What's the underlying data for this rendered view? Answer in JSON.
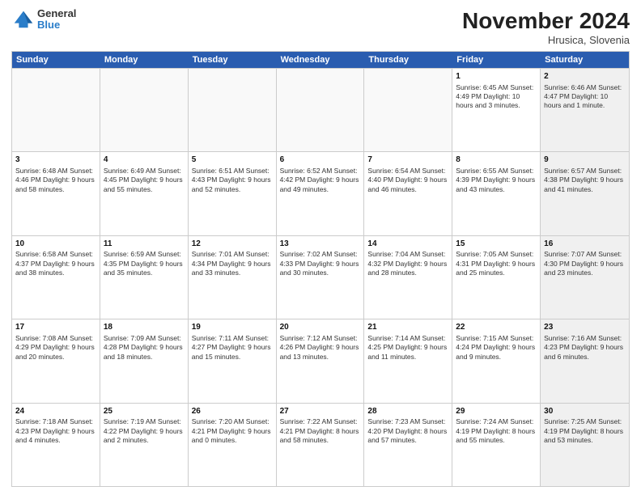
{
  "header": {
    "logo_line1": "General",
    "logo_line2": "Blue",
    "month": "November 2024",
    "location": "Hrusica, Slovenia"
  },
  "days": [
    "Sunday",
    "Monday",
    "Tuesday",
    "Wednesday",
    "Thursday",
    "Friday",
    "Saturday"
  ],
  "weeks": [
    [
      {
        "date": "",
        "info": "",
        "empty": true
      },
      {
        "date": "",
        "info": "",
        "empty": true
      },
      {
        "date": "",
        "info": "",
        "empty": true
      },
      {
        "date": "",
        "info": "",
        "empty": true
      },
      {
        "date": "",
        "info": "",
        "empty": true
      },
      {
        "date": "1",
        "info": "Sunrise: 6:45 AM\nSunset: 4:49 PM\nDaylight: 10 hours\nand 3 minutes.",
        "shaded": false
      },
      {
        "date": "2",
        "info": "Sunrise: 6:46 AM\nSunset: 4:47 PM\nDaylight: 10 hours\nand 1 minute.",
        "shaded": true
      }
    ],
    [
      {
        "date": "3",
        "info": "Sunrise: 6:48 AM\nSunset: 4:46 PM\nDaylight: 9 hours\nand 58 minutes.",
        "shaded": false
      },
      {
        "date": "4",
        "info": "Sunrise: 6:49 AM\nSunset: 4:45 PM\nDaylight: 9 hours\nand 55 minutes.",
        "shaded": false
      },
      {
        "date": "5",
        "info": "Sunrise: 6:51 AM\nSunset: 4:43 PM\nDaylight: 9 hours\nand 52 minutes.",
        "shaded": false
      },
      {
        "date": "6",
        "info": "Sunrise: 6:52 AM\nSunset: 4:42 PM\nDaylight: 9 hours\nand 49 minutes.",
        "shaded": false
      },
      {
        "date": "7",
        "info": "Sunrise: 6:54 AM\nSunset: 4:40 PM\nDaylight: 9 hours\nand 46 minutes.",
        "shaded": false
      },
      {
        "date": "8",
        "info": "Sunrise: 6:55 AM\nSunset: 4:39 PM\nDaylight: 9 hours\nand 43 minutes.",
        "shaded": false
      },
      {
        "date": "9",
        "info": "Sunrise: 6:57 AM\nSunset: 4:38 PM\nDaylight: 9 hours\nand 41 minutes.",
        "shaded": true
      }
    ],
    [
      {
        "date": "10",
        "info": "Sunrise: 6:58 AM\nSunset: 4:37 PM\nDaylight: 9 hours\nand 38 minutes.",
        "shaded": false
      },
      {
        "date": "11",
        "info": "Sunrise: 6:59 AM\nSunset: 4:35 PM\nDaylight: 9 hours\nand 35 minutes.",
        "shaded": false
      },
      {
        "date": "12",
        "info": "Sunrise: 7:01 AM\nSunset: 4:34 PM\nDaylight: 9 hours\nand 33 minutes.",
        "shaded": false
      },
      {
        "date": "13",
        "info": "Sunrise: 7:02 AM\nSunset: 4:33 PM\nDaylight: 9 hours\nand 30 minutes.",
        "shaded": false
      },
      {
        "date": "14",
        "info": "Sunrise: 7:04 AM\nSunset: 4:32 PM\nDaylight: 9 hours\nand 28 minutes.",
        "shaded": false
      },
      {
        "date": "15",
        "info": "Sunrise: 7:05 AM\nSunset: 4:31 PM\nDaylight: 9 hours\nand 25 minutes.",
        "shaded": false
      },
      {
        "date": "16",
        "info": "Sunrise: 7:07 AM\nSunset: 4:30 PM\nDaylight: 9 hours\nand 23 minutes.",
        "shaded": true
      }
    ],
    [
      {
        "date": "17",
        "info": "Sunrise: 7:08 AM\nSunset: 4:29 PM\nDaylight: 9 hours\nand 20 minutes.",
        "shaded": false
      },
      {
        "date": "18",
        "info": "Sunrise: 7:09 AM\nSunset: 4:28 PM\nDaylight: 9 hours\nand 18 minutes.",
        "shaded": false
      },
      {
        "date": "19",
        "info": "Sunrise: 7:11 AM\nSunset: 4:27 PM\nDaylight: 9 hours\nand 15 minutes.",
        "shaded": false
      },
      {
        "date": "20",
        "info": "Sunrise: 7:12 AM\nSunset: 4:26 PM\nDaylight: 9 hours\nand 13 minutes.",
        "shaded": false
      },
      {
        "date": "21",
        "info": "Sunrise: 7:14 AM\nSunset: 4:25 PM\nDaylight: 9 hours\nand 11 minutes.",
        "shaded": false
      },
      {
        "date": "22",
        "info": "Sunrise: 7:15 AM\nSunset: 4:24 PM\nDaylight: 9 hours\nand 9 minutes.",
        "shaded": false
      },
      {
        "date": "23",
        "info": "Sunrise: 7:16 AM\nSunset: 4:23 PM\nDaylight: 9 hours\nand 6 minutes.",
        "shaded": true
      }
    ],
    [
      {
        "date": "24",
        "info": "Sunrise: 7:18 AM\nSunset: 4:23 PM\nDaylight: 9 hours\nand 4 minutes.",
        "shaded": false
      },
      {
        "date": "25",
        "info": "Sunrise: 7:19 AM\nSunset: 4:22 PM\nDaylight: 9 hours\nand 2 minutes.",
        "shaded": false
      },
      {
        "date": "26",
        "info": "Sunrise: 7:20 AM\nSunset: 4:21 PM\nDaylight: 9 hours\nand 0 minutes.",
        "shaded": false
      },
      {
        "date": "27",
        "info": "Sunrise: 7:22 AM\nSunset: 4:21 PM\nDaylight: 8 hours\nand 58 minutes.",
        "shaded": false
      },
      {
        "date": "28",
        "info": "Sunrise: 7:23 AM\nSunset: 4:20 PM\nDaylight: 8 hours\nand 57 minutes.",
        "shaded": false
      },
      {
        "date": "29",
        "info": "Sunrise: 7:24 AM\nSunset: 4:19 PM\nDaylight: 8 hours\nand 55 minutes.",
        "shaded": false
      },
      {
        "date": "30",
        "info": "Sunrise: 7:25 AM\nSunset: 4:19 PM\nDaylight: 8 hours\nand 53 minutes.",
        "shaded": true
      }
    ]
  ]
}
